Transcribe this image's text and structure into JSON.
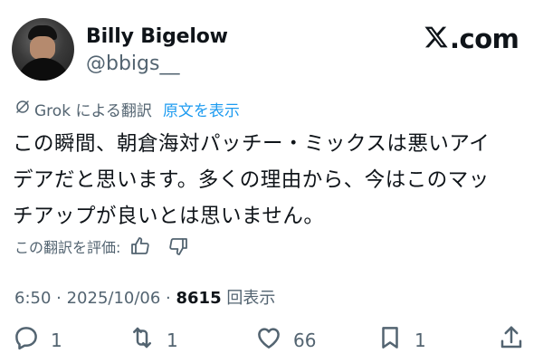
{
  "author": {
    "display_name": "Billy Bigelow",
    "handle": "@bbigs__"
  },
  "brand": {
    "logo_icon": "x-logo-icon",
    "suffix": ".com"
  },
  "translation": {
    "label": "Grok による翻訳",
    "show_original": "原文を表示",
    "icon": "grok-icon"
  },
  "tweet": {
    "lines": [
      "この瞬間、朝倉海対パッチー・ミックスは悪いアイ",
      "デアだと思います。多くの理由から、今はこのマッ",
      "チアップが良いとは思いません。"
    ]
  },
  "rating": {
    "label": "この翻訳を評価:",
    "thumbs_up_icon": "thumbs-up-icon",
    "thumbs_down_icon": "thumbs-down-icon"
  },
  "meta": {
    "time_date": "6:50 · 2025/10/06 · ",
    "views_count": "8615",
    "views_label": " 回表示"
  },
  "actions": {
    "reply": {
      "icon": "reply-icon",
      "count": "1"
    },
    "repost": {
      "icon": "repost-icon",
      "count": "1"
    },
    "like": {
      "icon": "heart-icon",
      "count": "66"
    },
    "bookmark": {
      "icon": "bookmark-icon",
      "count": "1"
    },
    "share": {
      "icon": "share-icon"
    }
  },
  "colors": {
    "text": "#0f1419",
    "secondary": "#536471",
    "link": "#1d9bf0"
  }
}
